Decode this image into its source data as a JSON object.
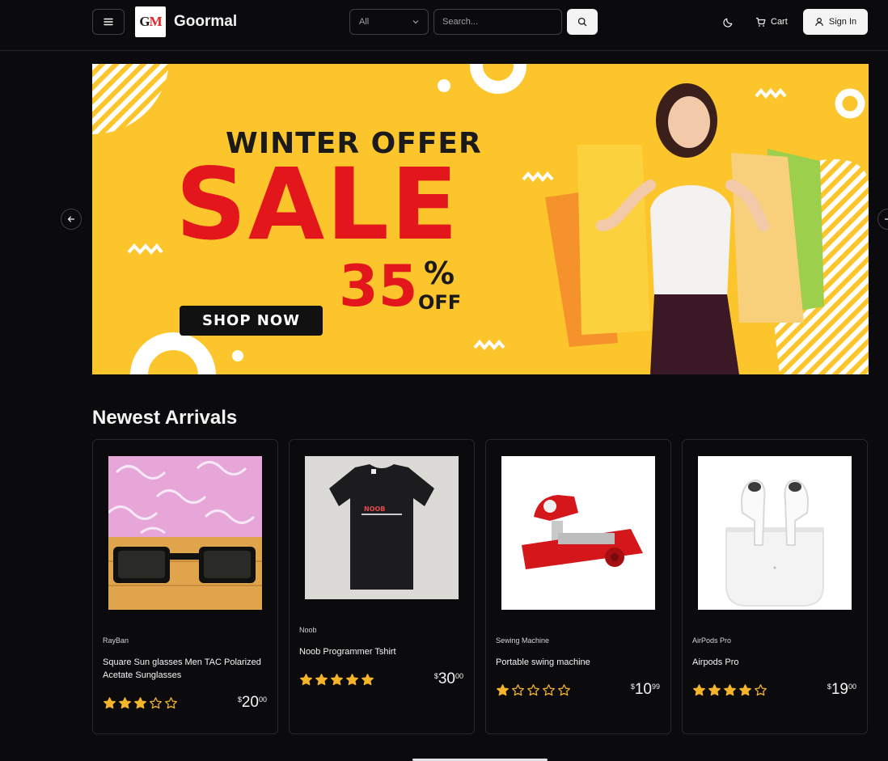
{
  "header": {
    "brand_name": "Goormal",
    "logo_text_left": "G",
    "logo_text_right": "M",
    "category_select": "All",
    "search_placeholder": "Search...",
    "cart_label": "Cart",
    "signin_label": "Sign In"
  },
  "banner": {
    "headline": "WINTER OFFER",
    "sale": "SALE",
    "discount": "35",
    "percent": "%",
    "off": "OFF",
    "cta": "SHOP NOW"
  },
  "section": {
    "title": "Newest Arrivals"
  },
  "products": [
    {
      "brand": "RayBan",
      "name": "Square Sun glasses Men TAC Polarized Acetate Sunglasses",
      "rating": 3,
      "max_rating": 5,
      "currency": "$",
      "price_whole": "20",
      "price_cents": "00"
    },
    {
      "brand": "Noob",
      "name": "Noob Programmer Tshirt",
      "rating": 5,
      "max_rating": 5,
      "currency": "$",
      "price_whole": "30",
      "price_cents": "00"
    },
    {
      "brand": "Sewing Machine",
      "name": "Portable swing machine",
      "rating": 1,
      "max_rating": 5,
      "currency": "$",
      "price_whole": "10",
      "price_cents": "99"
    },
    {
      "brand": "AirPods Pro",
      "name": "Airpods Pro",
      "rating": 4,
      "max_rating": 5,
      "currency": "$",
      "price_whole": "19",
      "price_cents": "00"
    }
  ],
  "tshirt_print": "NOOB",
  "colors": {
    "accent_star": "#f5b42a",
    "background": "#0b0b0d",
    "banner_yellow": "#fcc52b",
    "sale_red": "#e3161c"
  }
}
